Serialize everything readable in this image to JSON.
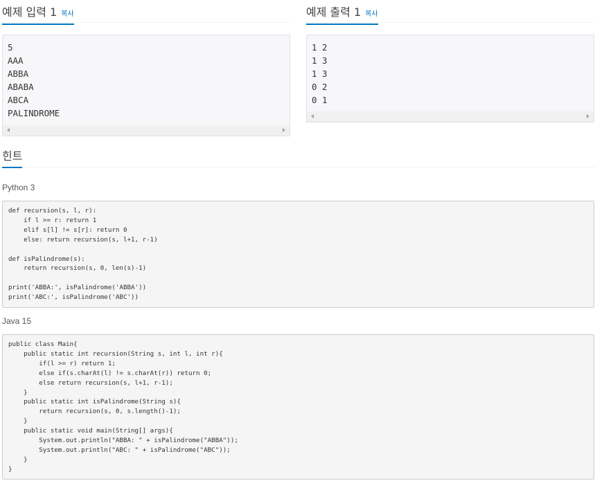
{
  "sample_input": {
    "title": "예제 입력 1",
    "copy_label": "복사",
    "lines": [
      "5",
      "AAA",
      "ABBA",
      "ABABA",
      "ABCA",
      "PALINDROME"
    ]
  },
  "sample_output": {
    "title": "예제 출력 1",
    "copy_label": "복사",
    "lines": [
      "1 2",
      "1 3",
      "1 3",
      "0 2",
      "0 1"
    ]
  },
  "hint": {
    "title": "힌트"
  },
  "code_blocks": [
    {
      "language": "Python 3",
      "code": "def recursion(s, l, r):\n    if l >= r: return 1\n    elif s[l] != s[r]: return 0\n    else: return recursion(s, l+1, r-1)\n\ndef isPalindrome(s):\n    return recursion(s, 0, len(s)-1)\n\nprint('ABBA:', isPalindrome('ABBA'))\nprint('ABC:', isPalindrome('ABC'))"
    },
    {
      "language": "Java 15",
      "code": "public class Main{\n    public static int recursion(String s, int l, int r){\n        if(l >= r) return 1;\n        else if(s.charAt(l) != s.charAt(r)) return 0;\n        else return recursion(s, l+1, r-1);\n    }\n    public static int isPalindrome(String s){\n        return recursion(s, 0, s.length()-1);\n    }\n    public static void main(String[] args){\n        System.out.println(\"ABBA: \" + isPalindrome(\"ABBA\"));\n        System.out.println(\"ABC: \" + isPalindrome(\"ABC\"));\n    }\n}"
    }
  ],
  "colors": {
    "accent": "#0076c0",
    "sample_bg": "#f7f7f9",
    "code_bg": "#f5f5f5"
  },
  "icons": [
    "scroll-left-arrow-icon",
    "scroll-right-arrow-icon"
  ]
}
